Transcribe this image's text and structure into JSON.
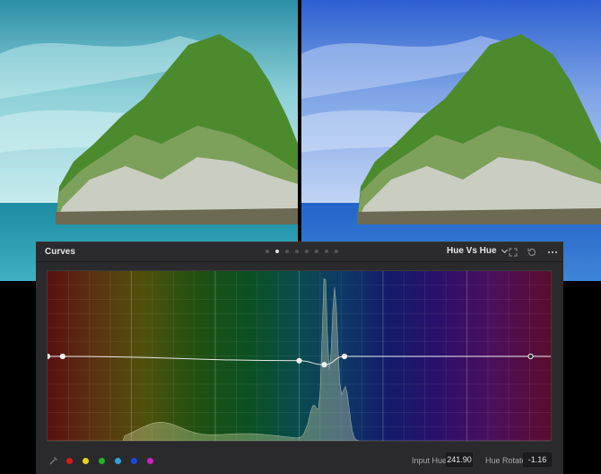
{
  "viewer": {
    "before_label": "",
    "after_label": ""
  },
  "panel": {
    "title": "Curves",
    "page_count": 8,
    "active_page": 2,
    "mode": "Hue Vs Hue",
    "icons": [
      "expand-icon",
      "reset-icon",
      "more-options-icon"
    ]
  },
  "curve": {
    "points": [
      {
        "hue": 0,
        "rotate": 0
      },
      {
        "hue": 3,
        "rotate": 0
      },
      {
        "hue": 50,
        "rotate": -0.6
      },
      {
        "hue": 55,
        "rotate": -1.16
      },
      {
        "hue": 59,
        "rotate": 0
      },
      {
        "hue": 96,
        "rotate": 0
      }
    ]
  },
  "footer": {
    "swatches": [
      {
        "name": "red",
        "color": "#e0161b"
      },
      {
        "name": "yellow",
        "color": "#e7d315"
      },
      {
        "name": "green",
        "color": "#1fb726"
      },
      {
        "name": "cyan",
        "color": "#2fa4dc"
      },
      {
        "name": "blue",
        "color": "#1f44e5"
      },
      {
        "name": "magenta",
        "color": "#d41fbf"
      }
    ],
    "input_hue_label": "Input Hue",
    "input_hue_value": "241.90",
    "hue_rotate_label": "Hue Rotate",
    "hue_rotate_value": "-1.16"
  }
}
